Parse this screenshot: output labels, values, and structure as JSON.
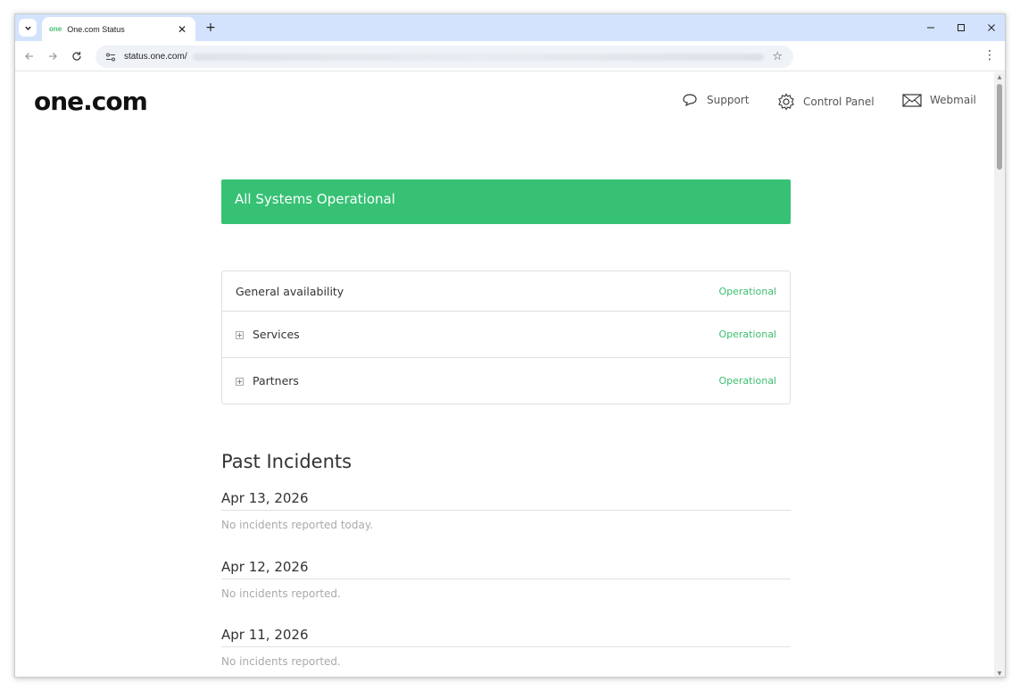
{
  "browser": {
    "tab_favicon": "one",
    "tab_title": "One.com Status",
    "url": "status.one.com/"
  },
  "site": {
    "logo": "one.com",
    "nav": {
      "support": "Support",
      "control_panel": "Control Panel",
      "webmail": "Webmail"
    }
  },
  "status_banner": "All Systems Operational",
  "components": [
    {
      "name": "General availability",
      "status": "Operational",
      "expandable": false
    },
    {
      "name": "Services",
      "status": "Operational",
      "expandable": true
    },
    {
      "name": "Partners",
      "status": "Operational",
      "expandable": true
    }
  ],
  "past_incidents": {
    "title": "Past Incidents",
    "days": [
      {
        "date": "Apr 13, 2026",
        "message": "No incidents reported today."
      },
      {
        "date": "Apr 12, 2026",
        "message": "No incidents reported."
      },
      {
        "date": "Apr 11, 2026",
        "message": "No incidents reported."
      }
    ]
  },
  "colors": {
    "banner_green": "#36c174",
    "status_green": "#3dbf6f",
    "tabstrip_blue": "#d3e3fd"
  }
}
